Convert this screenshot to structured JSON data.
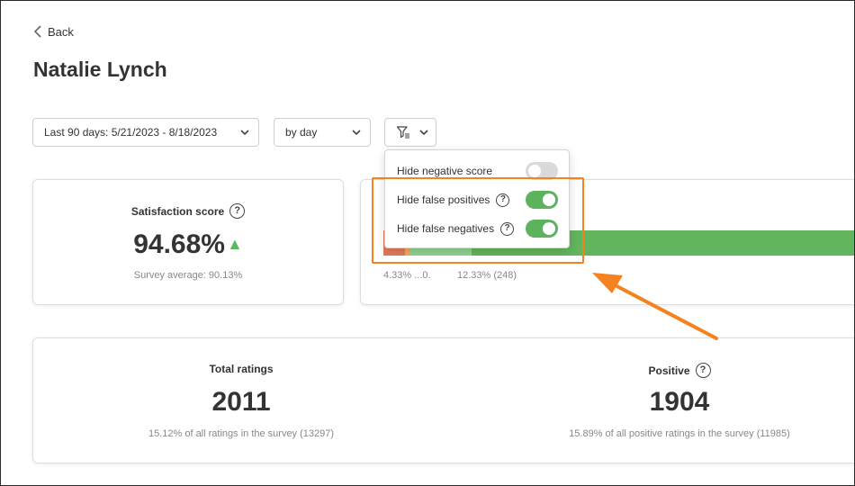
{
  "nav": {
    "back_label": "Back"
  },
  "page": {
    "title": "Natalie Lynch"
  },
  "filters": {
    "date_range": "Last 90 days: 5/21/2023 - 8/18/2023",
    "granularity": "by day",
    "filter_icon": "funnel-filter-icon"
  },
  "filter_menu": {
    "items": [
      {
        "label": "Hide negative score",
        "has_help": false,
        "enabled": false
      },
      {
        "label": "Hide false positives",
        "has_help": true,
        "enabled": true
      },
      {
        "label": "Hide false negatives",
        "has_help": true,
        "enabled": true
      }
    ]
  },
  "satisfaction": {
    "label": "Satisfaction score",
    "value": "94.68%",
    "trend": "▲",
    "subtext": "Survey average: 90.13%"
  },
  "distribution": {
    "segments": [
      {
        "name": "negative",
        "color": "#e07a5a",
        "share": 4.33
      },
      {
        "name": "neutral",
        "color": "#f0a860",
        "share": 0.9
      },
      {
        "name": "light-positive",
        "color": "#8fd18f",
        "share": 12.33
      },
      {
        "name": "positive",
        "color": "#62b55c",
        "share": 82.44
      }
    ],
    "label_1": "4.33% ...0.",
    "label_2": "12.33% (248)"
  },
  "totals": {
    "total_label": "Total ratings",
    "total_value": "2011",
    "total_sub": "15.12% of all ratings in the survey (13297)",
    "positive_label": "Positive",
    "positive_value": "1904",
    "positive_sub": "15.89% of all positive ratings in the survey (11985)"
  },
  "colors": {
    "accent_green": "#5cb35c",
    "annotation_orange": "#f5821f"
  }
}
